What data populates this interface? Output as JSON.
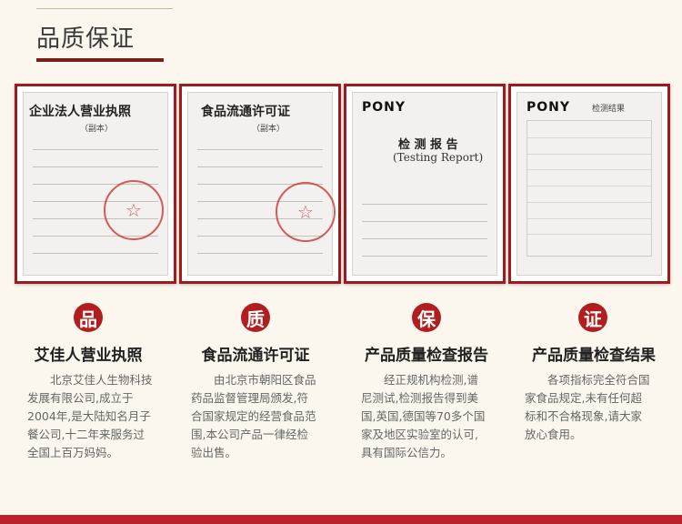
{
  "header": {
    "title": "品质保证"
  },
  "cards": [
    {
      "doc_title": "企业法人营业执照",
      "doc_subtitle": "（副本）",
      "stamp_text": "☆",
      "badge": "品",
      "title": "艾佳人营业执照",
      "description": "北京艾佳人生物科技发展有限公司,成立于2004年,是大陆知名月子餐公司,十二年来服务过全国上百万妈妈。"
    },
    {
      "doc_title": "食品流通许可证",
      "doc_subtitle": "（副本）",
      "stamp_text": "☆",
      "badge": "质",
      "title": "食品流通许可证",
      "description": "由北京市朝阳区食品药品监督管理局颁发,符合国家规定的经营食品范围,本公司产品一律经检验出售。"
    },
    {
      "doc_title": "检 测 报 告",
      "doc_subtitle": "(Testing Report)",
      "brand": "PONY",
      "badge": "保",
      "title": "产品质量检查报告",
      "description": "经正规机构检测,谱尼测试,检测报告得到美国,英国,德国等70多个国家及地区实验室的认可,具有国际公信力。"
    },
    {
      "doc_title": "检测结果",
      "brand": "PONY",
      "badge": "证",
      "title": "产品质量检查结果",
      "description": "各项指标完全符合国家食品规定,未有任何超标和不合格现象,请大家放心食用。"
    }
  ],
  "colors": {
    "accent": "#b11e1d",
    "frame": "#9b1c1f",
    "background": "#fbf7ee"
  }
}
